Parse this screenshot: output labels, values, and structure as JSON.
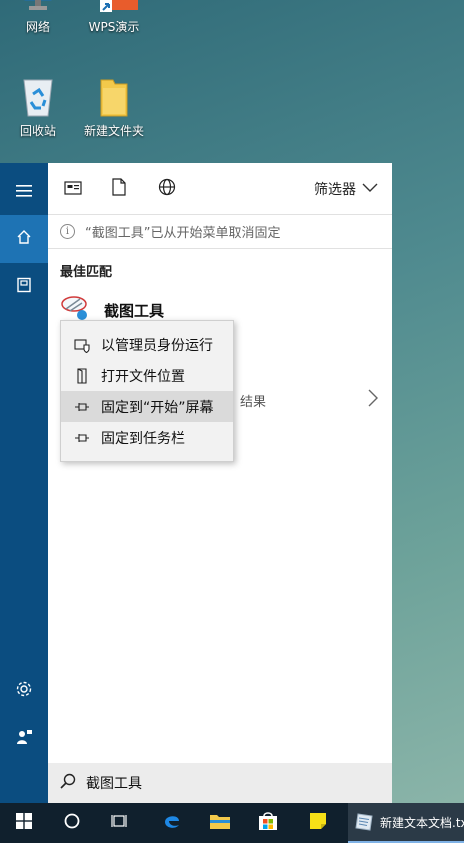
{
  "desktop": {
    "icons": [
      {
        "label": "网络"
      },
      {
        "label": "WPS演示"
      },
      {
        "label": "回收站"
      },
      {
        "label": "新建文件夹"
      }
    ]
  },
  "start_menu": {
    "rail": {
      "hamburger": "hamburger-icon",
      "home": "home-icon",
      "notebook": "notebook-icon",
      "settings": "gear-icon",
      "feedback": "feedback-icon"
    },
    "topbar": {
      "filter_label": "筛选器"
    },
    "notice": "“截图工具”已从开始菜单取消固定",
    "best_match_label": "最佳匹配",
    "best_match": {
      "name": "截图工具"
    },
    "web_results_partial": "结果",
    "search_value": "截图工具"
  },
  "context_menu": {
    "items": [
      {
        "label": "以管理员身份运行",
        "icon": "admin-shield-icon"
      },
      {
        "label": "打开文件位置",
        "icon": "file-location-icon"
      },
      {
        "label": "固定到“开始”屏幕",
        "icon": "pin-icon",
        "highlighted": true
      },
      {
        "label": "固定到任务栏",
        "icon": "pin-icon"
      }
    ]
  },
  "taskbar": {
    "active_app": "新建文本文档.txt"
  },
  "colors": {
    "rail": "#0b4d80",
    "rail_active": "#1e73b4",
    "taskbar": "#10202d"
  }
}
